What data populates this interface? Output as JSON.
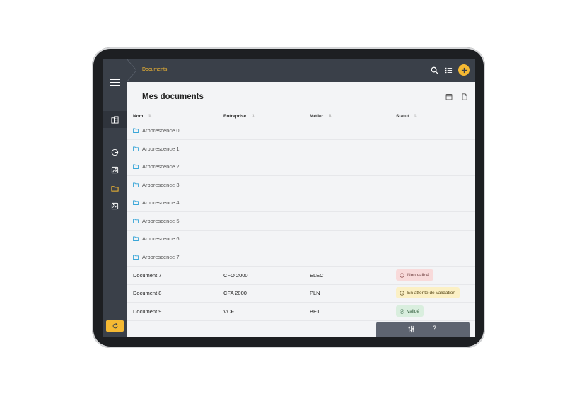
{
  "header": {
    "breadcrumb": "Documents"
  },
  "page": {
    "title": "Mes documents"
  },
  "table": {
    "columns": [
      {
        "label": "Nom",
        "sort_icon": "sort-icon"
      },
      {
        "label": "Entreprise",
        "sort_icon": "sort-icon"
      },
      {
        "label": "Métier",
        "sort_icon": "sort-icon"
      },
      {
        "label": "Statut",
        "sort_icon": "sort-icon"
      }
    ],
    "folders": [
      {
        "name": "Arborescence 0"
      },
      {
        "name": "Arborescence 1"
      },
      {
        "name": "Arborescence 2"
      },
      {
        "name": "Arborescence 3"
      },
      {
        "name": "Arborescence 4"
      },
      {
        "name": "Arborescence 5"
      },
      {
        "name": "Arborescence 6"
      },
      {
        "name": "Arborescence 7"
      }
    ],
    "documents": [
      {
        "name": "Document 7",
        "entreprise": "CFO 2000",
        "metier": "ELEC",
        "statut": "Non validé",
        "status_type": "error"
      },
      {
        "name": "Document 8",
        "entreprise": "CFA 2000",
        "metier": "PLN",
        "statut": "En attente de validation",
        "status_type": "pending"
      },
      {
        "name": "Document 9",
        "entreprise": "VCF",
        "metier": "BET",
        "statut": "validé",
        "status_type": "ok"
      }
    ]
  },
  "toolbar": {
    "help_label": "?"
  },
  "colors": {
    "accent": "#f5b933",
    "sidebar": "#3a4049",
    "folder_icon": "#3aa6d8",
    "status_error_bg": "#f8dada",
    "status_pending_bg": "#fbf0c5",
    "status_ok_bg": "#d9eede"
  },
  "icons": [
    "menu-icon",
    "building-icon",
    "pie-chart-icon",
    "image-icon",
    "folder-icon",
    "photo-icon",
    "refresh-icon",
    "search-icon",
    "list-icon",
    "plus-icon",
    "calendar-icon",
    "document-icon",
    "filter-icon",
    "help-icon"
  ]
}
